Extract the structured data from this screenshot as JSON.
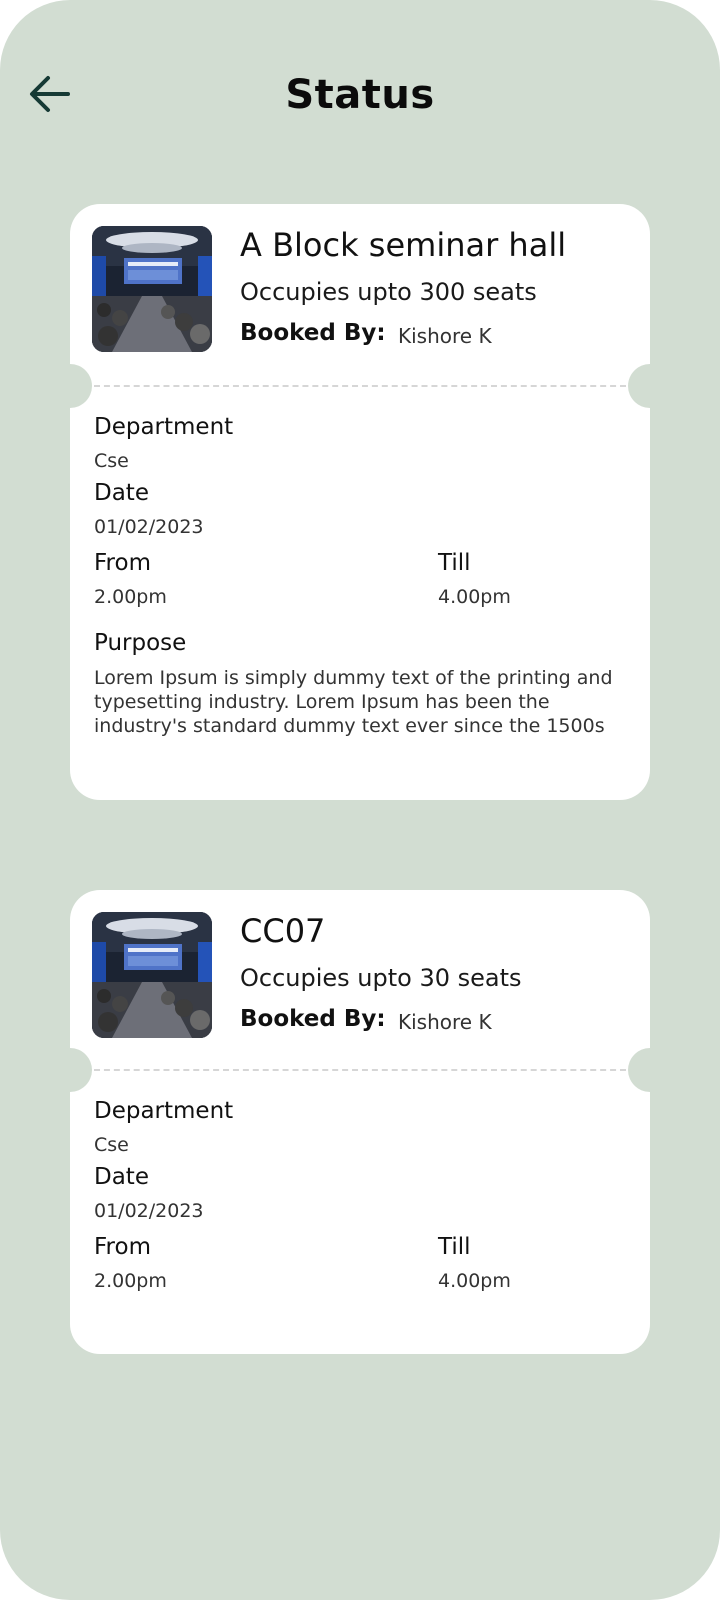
{
  "header": {
    "title": "Status",
    "back_icon": "arrow-left-icon"
  },
  "bookings": [
    {
      "venue": "A Block seminar hall",
      "capacity": "Occupies upto 300 seats",
      "booked_by_label": "Booked By:",
      "booked_by": "Kishore K",
      "department_label": "Department",
      "department": "Cse",
      "date_label": "Date",
      "date": "01/02/2023",
      "from_label": "From",
      "from": "2.00pm",
      "till_label": "Till",
      "till": "4.00pm",
      "purpose_label": "Purpose",
      "purpose": "Lorem Ipsum is simply dummy text of the printing and typesetting industry. Lorem Ipsum has been the industry's standard dummy text ever since the 1500s"
    },
    {
      "venue": "CC07",
      "capacity": "Occupies upto 30 seats",
      "booked_by_label": "Booked By:",
      "booked_by": "Kishore K",
      "department_label": "Department",
      "department": "Cse",
      "date_label": "Date",
      "date": "01/02/2023",
      "from_label": "From",
      "from": "2.00pm",
      "till_label": "Till",
      "till": "4.00pm"
    }
  ],
  "colors": {
    "background": "#d2ddd2",
    "card": "#ffffff",
    "text": "#111111"
  }
}
